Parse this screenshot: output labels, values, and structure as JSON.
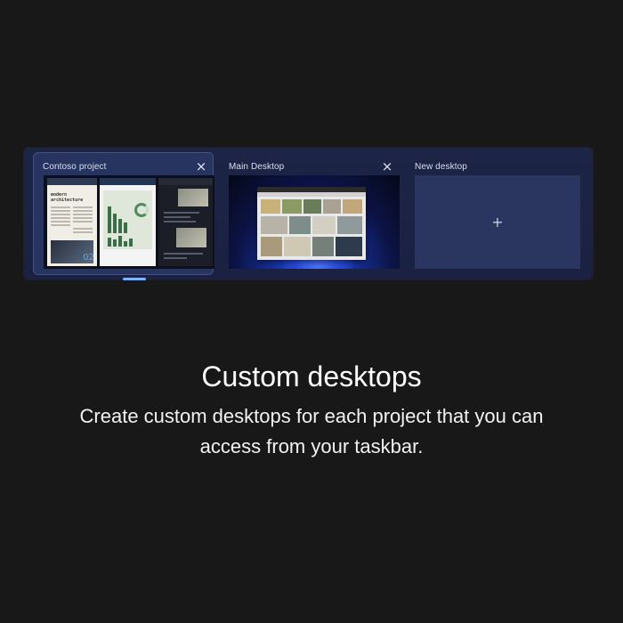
{
  "task_view": {
    "desktops": [
      {
        "label": "Contoso project",
        "close_icon": "×",
        "active": true
      },
      {
        "label": "Main Desktop",
        "close_icon": "×",
        "active": false
      },
      {
        "label": "New desktop",
        "add_icon": "+"
      }
    ],
    "thumbnail_text": {
      "doc_title": "modern architecture",
      "doc_number": "02"
    },
    "colors": {
      "strip_background": "#1d2547",
      "active_card": "#27345f",
      "active_indicator": "#7fb3ff"
    }
  },
  "caption": {
    "title": "Custom desktops",
    "body": "Create custom desktops for each project that you can access from your taskbar."
  }
}
